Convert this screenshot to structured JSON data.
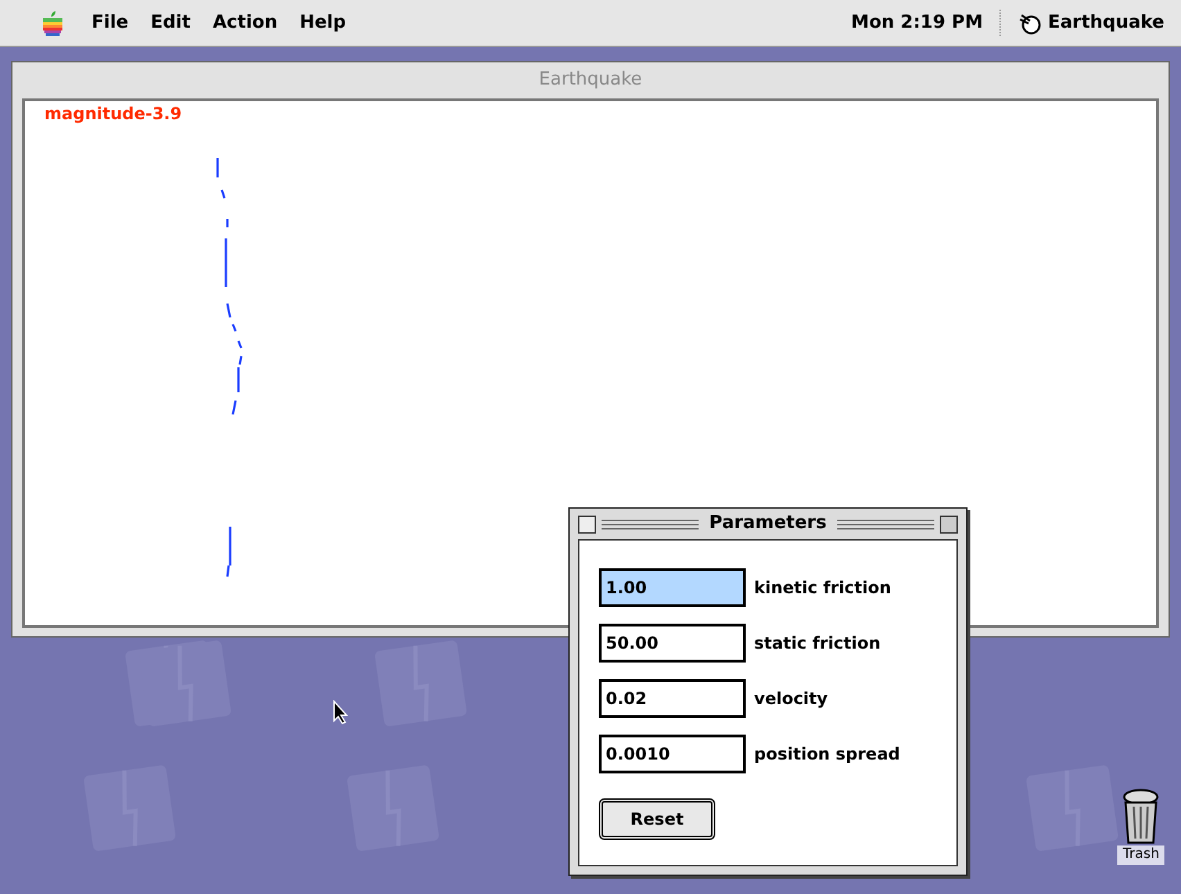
{
  "menu_bar": {
    "menus": [
      "File",
      "Edit",
      "Action",
      "Help"
    ],
    "clock": "Mon 2:19 PM",
    "app_name": "Earthquake"
  },
  "main_window": {
    "title": "Earthquake",
    "magnitude_label": "magnitude-3.9"
  },
  "parameters_window": {
    "title": "Parameters",
    "fields": [
      {
        "value": "1.00",
        "label": "kinetic friction",
        "selected": true
      },
      {
        "value": "50.00",
        "label": "static friction",
        "selected": false
      },
      {
        "value": "0.02",
        "label": "velocity",
        "selected": false
      },
      {
        "value": "0.0010",
        "label": "position spread",
        "selected": false
      }
    ],
    "buttons": [
      "Reset"
    ]
  },
  "desktop": {
    "trash_label": "Trash"
  }
}
